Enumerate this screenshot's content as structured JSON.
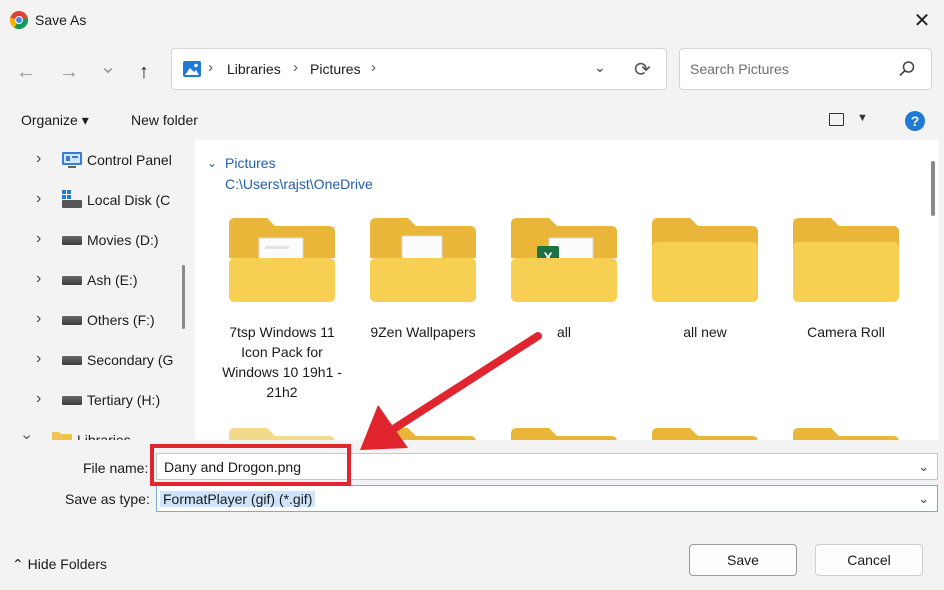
{
  "window": {
    "title": "Save As",
    "close_glyph": "✕"
  },
  "nav": {
    "back_glyph": "←",
    "forward_glyph": "→",
    "recent_glyph": "⌄",
    "up_glyph": "↑",
    "breadcrumb": [
      "Libraries",
      "Pictures"
    ],
    "breadcrumb_sep": "›",
    "address_dropdown_glyph": "⌄",
    "refresh_glyph": "⟳",
    "search_placeholder": "Search Pictures"
  },
  "toolbar": {
    "organize_label": "Organize ▾",
    "new_folder_label": "New folder",
    "view_caret": "▼",
    "help_glyph": "?"
  },
  "sidebar": {
    "chevron": "›",
    "items": [
      {
        "label": "Control Panel",
        "icon": "control-panel-icon"
      },
      {
        "label": "Local Disk (C",
        "icon": "windows-drive-icon"
      },
      {
        "label": "Movies (D:)",
        "icon": "drive-icon"
      },
      {
        "label": "Ash (E:)",
        "icon": "drive-icon"
      },
      {
        "label": "Others (F:)",
        "icon": "drive-icon"
      },
      {
        "label": "Secondary (G",
        "icon": "drive-icon"
      },
      {
        "label": "Tertiary (H:)",
        "icon": "drive-icon"
      },
      {
        "label": "Libraries",
        "icon": "folder-icon"
      }
    ]
  },
  "content": {
    "group_chevron": "⌄",
    "group_title": "Pictures",
    "group_path": "C:\\Users\\rajst\\OneDrive",
    "folders": [
      {
        "label": "7tsp Windows 11 Icon Pack for Windows 10 19h1 - 21h2",
        "badge": "document"
      },
      {
        "label": "9Zen Wallpapers",
        "badge": "document"
      },
      {
        "label": "all",
        "badge": "excel"
      },
      {
        "label": "all new",
        "badge": "none"
      },
      {
        "label": "Camera Roll",
        "badge": "none"
      }
    ]
  },
  "form": {
    "file_name_label": "File name:",
    "file_name_value": "Dany and Drogon.png",
    "save_type_label": "Save as type:",
    "save_type_value": "FormatPlayer (gif) (*.gif)",
    "caret": "⌄"
  },
  "footer": {
    "hide_folders_label": "⌃  Hide Folders",
    "save_label": "Save",
    "cancel_label": "Cancel"
  },
  "colors": {
    "annotation_red": "#e0252f",
    "link_blue": "#1f5fa8",
    "folder_yellow": "#f7cf52"
  }
}
